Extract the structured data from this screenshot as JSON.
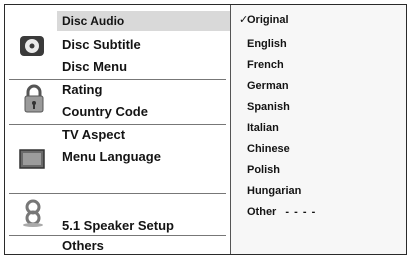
{
  "menu": {
    "items": [
      {
        "label": "Disc Audio"
      },
      {
        "label": "Disc Subtitle"
      },
      {
        "label": "Disc Menu"
      },
      {
        "label": "Rating"
      },
      {
        "label": "Country Code"
      },
      {
        "label": "TV Aspect"
      },
      {
        "label": "Menu Language"
      },
      {
        "label": "5.1 Speaker Setup"
      },
      {
        "label": "Others"
      }
    ]
  },
  "options": {
    "check_mark": "✓",
    "items": [
      {
        "label": "Original"
      },
      {
        "label": "English"
      },
      {
        "label": "French"
      },
      {
        "label": "German"
      },
      {
        "label": "Spanish"
      },
      {
        "label": "Italian"
      },
      {
        "label": "Chinese"
      },
      {
        "label": "Polish"
      },
      {
        "label": "Hungarian"
      },
      {
        "label": "Other"
      },
      {
        "label": "- - - -"
      }
    ]
  },
  "icons": [
    "disc-icon",
    "lock-icon",
    "tv-screen-icon",
    "speaker-icon"
  ]
}
